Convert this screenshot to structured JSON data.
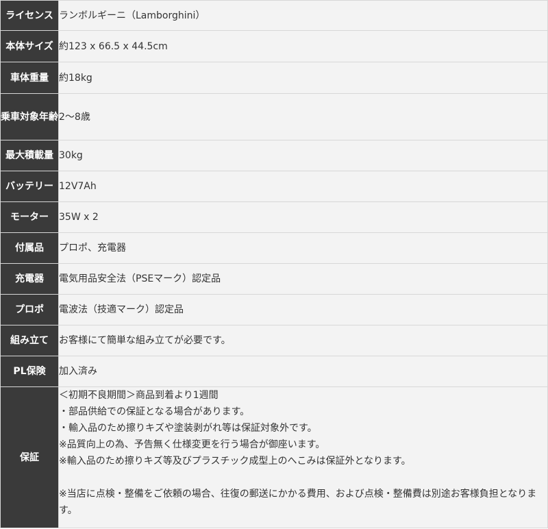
{
  "rows": [
    {
      "label": "ライセンス",
      "value": "ランボルギーニ（Lamborghini）"
    },
    {
      "label": "本体サイズ",
      "value": "約123 x 66.5 x 44.5cm"
    },
    {
      "label": "車体重量",
      "value": "約18kg"
    },
    {
      "label": "乗車対象年齢",
      "value": "2〜8歳"
    },
    {
      "label": "最大積載量",
      "value": "30kg"
    },
    {
      "label": "バッテリー",
      "value": "12V7Ah"
    },
    {
      "label": "モーター",
      "value": "35W x 2"
    },
    {
      "label": "付属品",
      "value": "プロポ、充電器"
    },
    {
      "label": "充電器",
      "value": "電気用品安全法（PSEマーク）認定品"
    },
    {
      "label": "プロポ",
      "value": "電波法（技適マーク）認定品"
    },
    {
      "label": "組み立て",
      "value": "お客様にて簡単な組み立てが必要です。"
    },
    {
      "label": "PL保険",
      "value": "加入済み"
    }
  ],
  "warranty": {
    "label": "保証",
    "lines": [
      "＜初期不良期間＞商品到着より1週間",
      "・部品供給での保証となる場合があります。",
      "・輸入品のため擦りキズや塗装剥がれ等は保証対象外です。",
      "※品質向上の為、予告無く仕様変更を行う場合が御座います。",
      "※輸入品のため擦りキズ等及びプラスチック成型上のへこみは保証外となります。",
      "",
      "※当店に点検・整備をご依頼の場合、往復の郵送にかかる費用、および点検・整備費は別途お客様負担となります。"
    ]
  }
}
